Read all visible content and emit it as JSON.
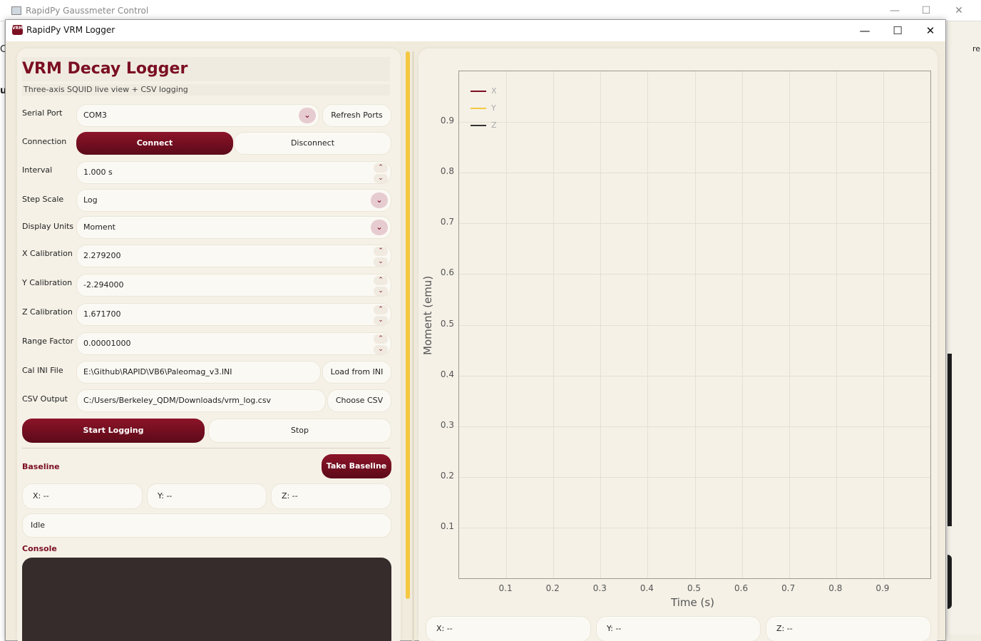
{
  "background_window": {
    "title": "RapidPy Gaussmeter Control",
    "minimize": "—",
    "maximize": "☐",
    "close": "✕",
    "edge_letters": [
      "C",
      "u",
      "re"
    ]
  },
  "window": {
    "title": "RapidPy VRM Logger",
    "icon_text": "VRM",
    "minimize": "—",
    "maximize": "☐",
    "close": "✕"
  },
  "header": {
    "title": "VRM Decay Logger",
    "subtitle": "Three-axis SQUID live view + CSV logging"
  },
  "form": {
    "serial_port": {
      "label": "Serial Port",
      "value": "COM3",
      "refresh_label": "Refresh Ports"
    },
    "connection": {
      "label": "Connection",
      "connect_label": "Connect",
      "disconnect_label": "Disconnect"
    },
    "interval": {
      "label": "Interval",
      "value": "1.000 s"
    },
    "step_scale": {
      "label": "Step Scale",
      "value": "Log"
    },
    "display_units": {
      "label": "Display Units",
      "value": "Moment"
    },
    "x_calibration": {
      "label": "X Calibration",
      "value": "2.279200"
    },
    "y_calibration": {
      "label": "Y Calibration",
      "value": "-2.294000"
    },
    "z_calibration": {
      "label": "Z Calibration",
      "value": "1.671700"
    },
    "range_factor": {
      "label": "Range Factor",
      "value": "0.00001000"
    },
    "cal_ini": {
      "label": "Cal INI File",
      "value": "E:\\Github\\RAPID\\VB6\\Paleomag_v3.INI",
      "load_label": "Load from INI"
    },
    "csv_output": {
      "label": "CSV Output",
      "value": "C:/Users/Berkeley_QDM/Downloads/vrm_log.csv",
      "choose_label": "Choose CSV"
    }
  },
  "logging": {
    "start_label": "Start Logging",
    "stop_label": "Stop"
  },
  "baseline": {
    "label": "Baseline",
    "take_label": "Take Baseline",
    "x": "X: --",
    "y": "Y: --",
    "z": "Z: --"
  },
  "status": {
    "value": "Idle"
  },
  "console": {
    "label": "Console"
  },
  "icons": {
    "chevron_down": "⌄",
    "spin_up": "⌃",
    "spin_down": "⌄"
  },
  "readout": {
    "x": "X: --",
    "y": "Y: --",
    "z": "Z: --"
  },
  "colors": {
    "accent": "#7b0f22",
    "x_series": "#7b0f22",
    "y_series": "#f5c842",
    "z_series": "#333333"
  },
  "chart_data": {
    "type": "line",
    "xlabel": "Time (s)",
    "ylabel": "Moment (emu)",
    "xlim": [
      0,
      1
    ],
    "ylim": [
      0,
      1
    ],
    "xticks": [
      "0.1",
      "0.2",
      "0.3",
      "0.4",
      "0.5",
      "0.6",
      "0.7",
      "0.8",
      "0.9"
    ],
    "yticks": [
      "0.9",
      "0.8",
      "0.7",
      "0.6",
      "0.5",
      "0.4",
      "0.3",
      "0.2",
      "0.1"
    ],
    "grid": true,
    "legend_position": "top-left",
    "series": [
      {
        "name": "X",
        "values": []
      },
      {
        "name": "Y",
        "values": []
      },
      {
        "name": "Z",
        "values": []
      }
    ]
  }
}
